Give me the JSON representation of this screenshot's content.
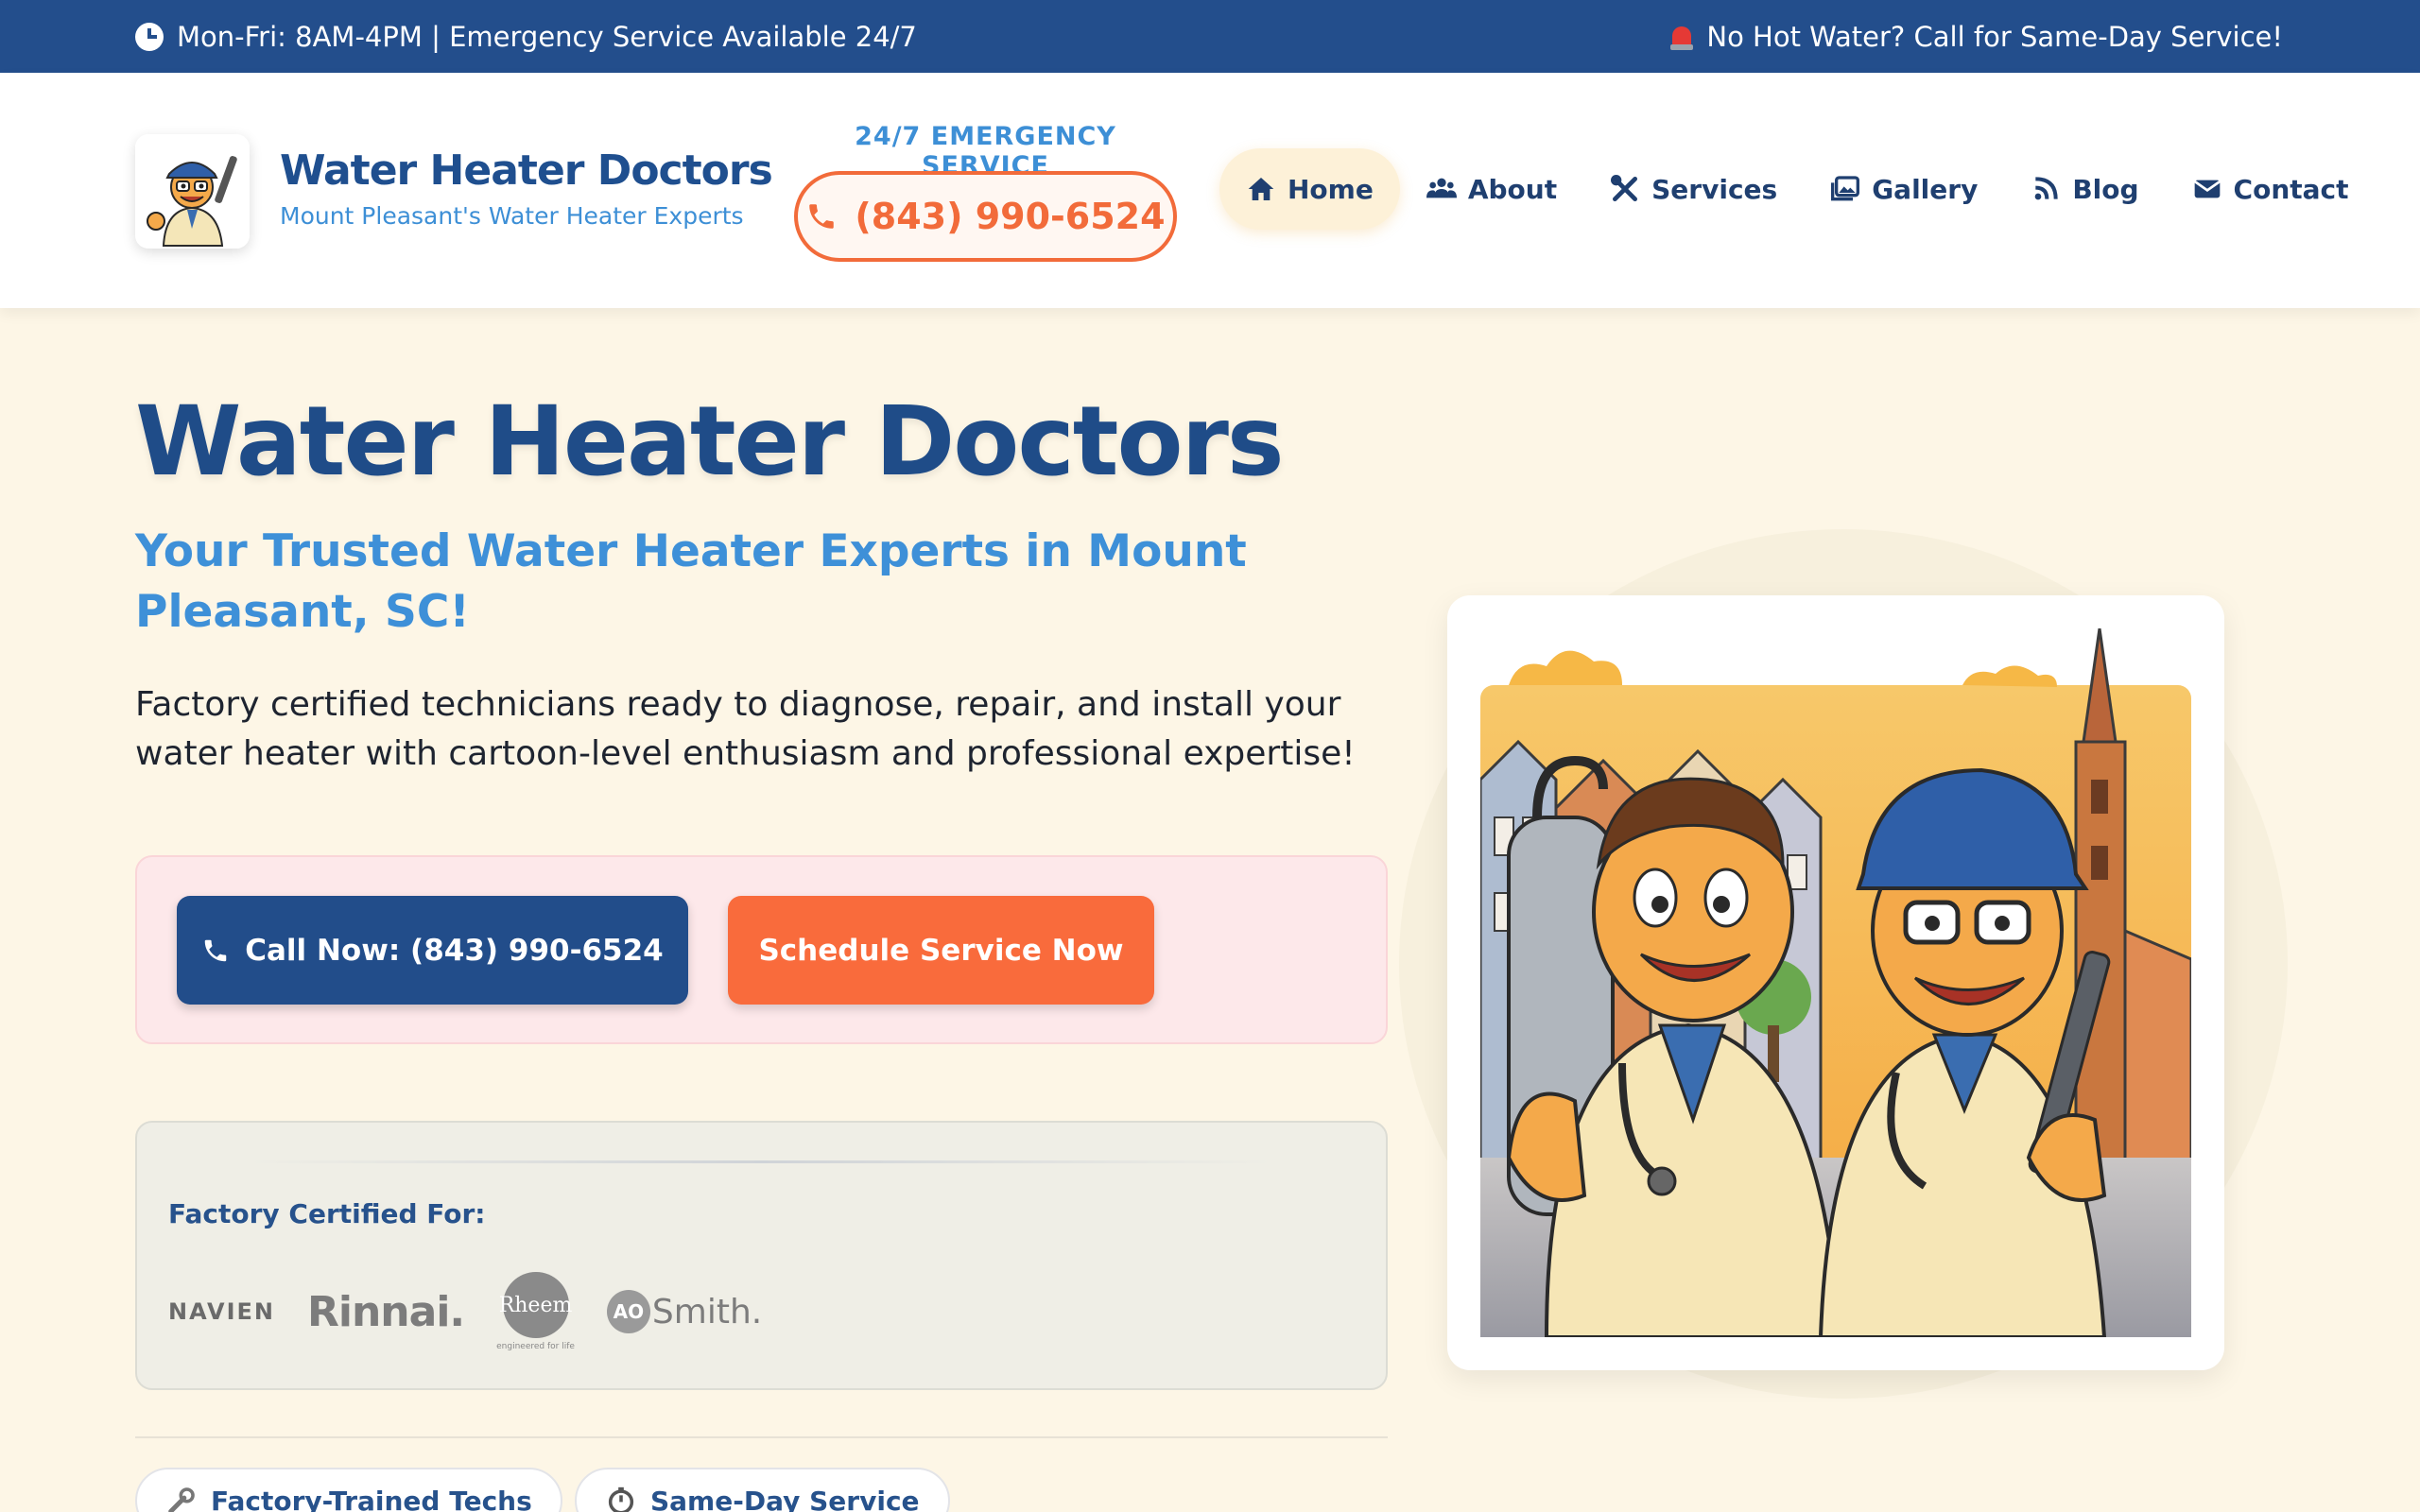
{
  "topbar": {
    "hours": "Mon-Fri: 8AM-4PM | Emergency Service Available 24/7",
    "alert": "No Hot Water? Call for Same-Day Service!",
    "hours_icon": "clock-icon",
    "alert_icon": "siren-icon"
  },
  "header": {
    "brand_name": "Water Heater Doctors",
    "brand_tagline": "Mount Pleasant's Water Heater Experts",
    "emergency_label": "24/7 EMERGENCY SERVICE",
    "phone": "(843) 990-6524"
  },
  "nav": {
    "items": [
      {
        "label": "Home",
        "icon": "home-icon",
        "active": true
      },
      {
        "label": "About",
        "icon": "users-icon"
      },
      {
        "label": "Services",
        "icon": "tools-icon"
      },
      {
        "label": "Gallery",
        "icon": "images-icon"
      },
      {
        "label": "Blog",
        "icon": "rss-icon"
      },
      {
        "label": "Contact",
        "icon": "envelope-icon"
      }
    ]
  },
  "hero": {
    "title": "Water Heater Doctors",
    "subtitle": "Your Trusted Water Heater Experts in Mount Pleasant, SC!",
    "description": "Factory certified technicians ready to diagnose, repair, and install your water heater with cartoon-level enthusiasm and professional expertise!",
    "call_button": "Call Now: (843) 990-6524",
    "schedule_button": "Schedule Service Now"
  },
  "certified": {
    "title": "Factory Certified For:",
    "brands": [
      "NAVIEN",
      "Rinnai.",
      "Rheem",
      "AOSmith"
    ],
    "rheem_tagline": "engineered for life",
    "aos_badge": "AO",
    "aos_text": "Smith."
  },
  "features": [
    {
      "label": "Factory-Trained Techs",
      "icon": "wrench-icon"
    },
    {
      "label": "Same-Day Service",
      "icon": "stopwatch-icon"
    }
  ],
  "colors": {
    "primary": "#234e8c",
    "accent": "#f96b3c",
    "sky": "#3e90d8",
    "cream": "#fdf6e6"
  }
}
